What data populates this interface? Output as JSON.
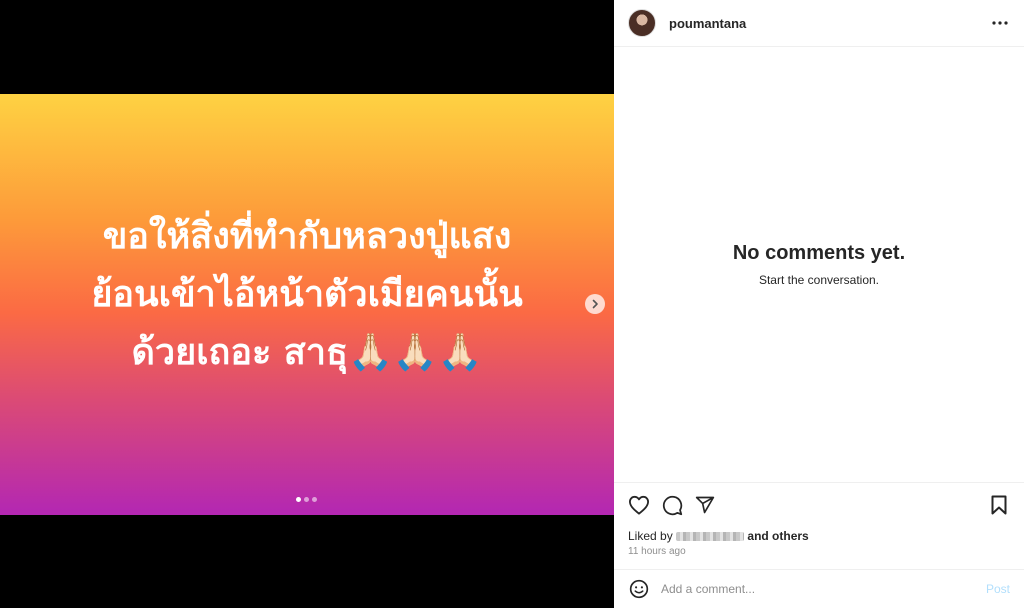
{
  "post": {
    "caption_lines": [
      "ขอให้สิ่งที่ทำกับหลวงปู่แสง",
      "ย้อนเข้าไอ้หน้าตัวเมียคนนั้น",
      "ด้วยเถอะ สาธุ🙏🏻🙏🏻🙏🏻"
    ],
    "carousel": {
      "count": 3,
      "active_index": 0
    },
    "background_colors": [
      "#fed242",
      "#fb6a44",
      "#b327b3"
    ]
  },
  "header": {
    "username": "poumantana"
  },
  "comments": {
    "empty_title": "No comments yet.",
    "empty_subtitle": "Start the conversation."
  },
  "likes": {
    "prefix": "Liked by",
    "suffix": "and others"
  },
  "timestamp": "11 hours ago",
  "comment_box": {
    "placeholder": "Add a comment...",
    "post_label": "Post"
  },
  "icons": [
    "heart-icon",
    "comment-icon",
    "share-icon",
    "bookmark-icon",
    "more-icon",
    "emoji-icon",
    "chevron-right-icon"
  ]
}
